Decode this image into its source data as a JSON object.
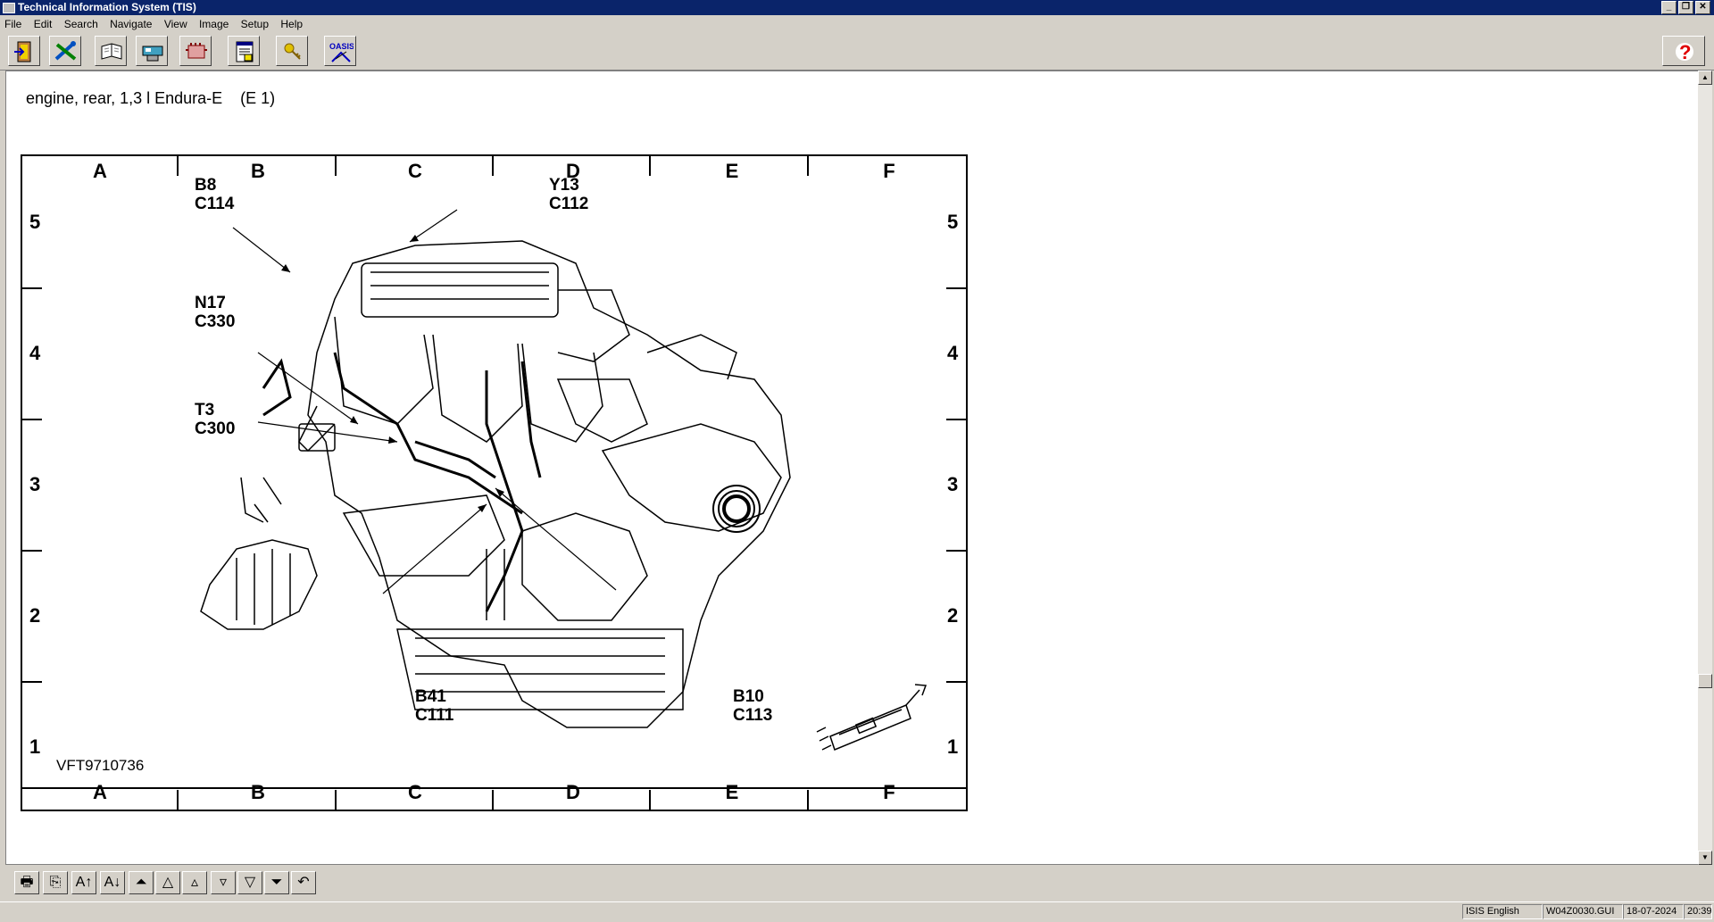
{
  "window": {
    "title": "Technical Information System (TIS)"
  },
  "menu": [
    "File",
    "Edit",
    "Search",
    "Navigate",
    "View",
    "Image",
    "Setup",
    "Help"
  ],
  "toolbar": {
    "icons": [
      "exit-icon",
      "tools-icon",
      "book-icon",
      "vehicle-icon",
      "engine-icon",
      "document-icon",
      "key-icon",
      "oasis-icon"
    ],
    "oasis_label": "OASIS",
    "help_icon": "help-icon"
  },
  "page": {
    "heading": "engine, rear, 1,3 l Endura-E    (E 1)"
  },
  "diagram": {
    "columns": [
      "A",
      "B",
      "C",
      "D",
      "E",
      "F"
    ],
    "rows": [
      "5",
      "4",
      "3",
      "2",
      "1"
    ],
    "labels": [
      {
        "id": "b8",
        "text": "B8\nC114"
      },
      {
        "id": "y13",
        "text": "Y13\nC112"
      },
      {
        "id": "n17",
        "text": "N17\nC330"
      },
      {
        "id": "t3",
        "text": "T3\nC300"
      },
      {
        "id": "b41",
        "text": "B41\nC111"
      },
      {
        "id": "b10",
        "text": "B10\nC113"
      }
    ],
    "reference": "VFT9710736"
  },
  "bottom_toolbar": [
    "print-icon",
    "copy-icon",
    "font-larger-icon",
    "font-smaller-icon",
    "first-page-icon",
    "page-up-icon",
    "line-up-icon",
    "line-down-icon",
    "page-down-icon",
    "last-page-icon",
    "back-icon"
  ],
  "status": {
    "language": "ISIS English",
    "file": "W04Z0030.GUI",
    "date": "18-07-2024",
    "time": "20:39"
  }
}
